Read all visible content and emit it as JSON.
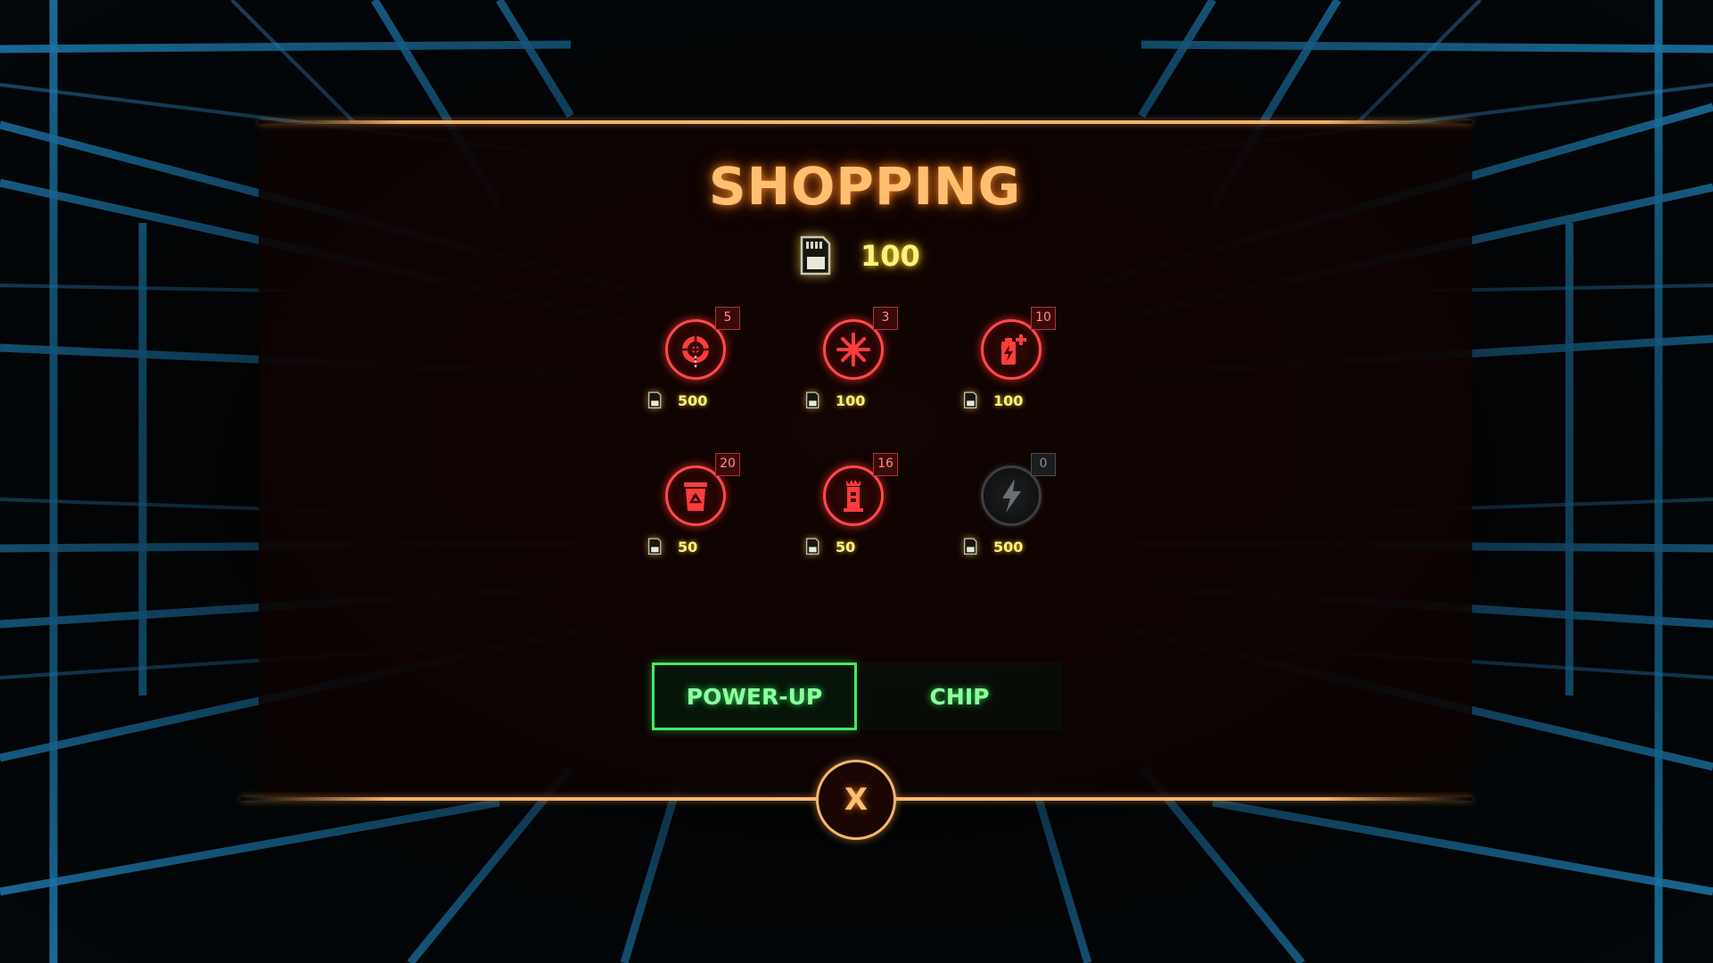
{
  "shop": {
    "title": "SHOPPING",
    "currency_icon": "memory-card-icon",
    "balance": "100"
  },
  "items": [
    {
      "icon": "target-crosshair-icon",
      "quantity": "5",
      "price": "500",
      "locked": false
    },
    {
      "icon": "snowflake-freeze-icon",
      "quantity": "3",
      "price": "100",
      "locked": false
    },
    {
      "icon": "battery-charge-plus-icon",
      "quantity": "10",
      "price": "100",
      "locked": false
    },
    {
      "icon": "recycle-bin-icon",
      "quantity": "20",
      "price": "50",
      "locked": false
    },
    {
      "icon": "tower-turret-icon",
      "quantity": "16",
      "price": "50",
      "locked": false
    },
    {
      "icon": "lightning-bolt-icon",
      "quantity": "0",
      "price": "500",
      "locked": true
    }
  ],
  "tabs": [
    {
      "label": "POWER-UP",
      "active": true
    },
    {
      "label": "CHIP",
      "active": false
    }
  ],
  "close_label": "X",
  "colors": {
    "accent_orange": "#ffbf70",
    "currency_yellow": "#fff07a",
    "item_red": "#ff4b4b",
    "tab_green": "#44e860",
    "grid_blue": "#1a6fa0"
  }
}
